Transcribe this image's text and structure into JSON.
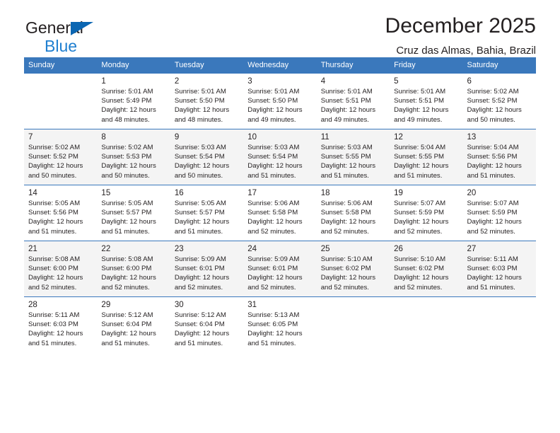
{
  "brand": {
    "line1": "General",
    "line2": "Blue",
    "triangle_color": "#0b66b2",
    "line2_color": "#1f7fd0"
  },
  "header": {
    "title": "December 2025",
    "location": "Cruz das Almas, Bahia, Brazil",
    "header_bg": "#3a78bc",
    "header_text_color": "#ffffff"
  },
  "calendar": {
    "weekdays": [
      "Sunday",
      "Monday",
      "Tuesday",
      "Wednesday",
      "Thursday",
      "Friday",
      "Saturday"
    ],
    "weeks": [
      [
        {
          "day": "",
          "lines": []
        },
        {
          "day": "1",
          "lines": [
            "Sunrise: 5:01 AM",
            "Sunset: 5:49 PM",
            "Daylight: 12 hours",
            "and 48 minutes."
          ]
        },
        {
          "day": "2",
          "lines": [
            "Sunrise: 5:01 AM",
            "Sunset: 5:50 PM",
            "Daylight: 12 hours",
            "and 48 minutes."
          ]
        },
        {
          "day": "3",
          "lines": [
            "Sunrise: 5:01 AM",
            "Sunset: 5:50 PM",
            "Daylight: 12 hours",
            "and 49 minutes."
          ]
        },
        {
          "day": "4",
          "lines": [
            "Sunrise: 5:01 AM",
            "Sunset: 5:51 PM",
            "Daylight: 12 hours",
            "and 49 minutes."
          ]
        },
        {
          "day": "5",
          "lines": [
            "Sunrise: 5:01 AM",
            "Sunset: 5:51 PM",
            "Daylight: 12 hours",
            "and 49 minutes."
          ]
        },
        {
          "day": "6",
          "lines": [
            "Sunrise: 5:02 AM",
            "Sunset: 5:52 PM",
            "Daylight: 12 hours",
            "and 50 minutes."
          ]
        }
      ],
      [
        {
          "day": "7",
          "lines": [
            "Sunrise: 5:02 AM",
            "Sunset: 5:52 PM",
            "Daylight: 12 hours",
            "and 50 minutes."
          ]
        },
        {
          "day": "8",
          "lines": [
            "Sunrise: 5:02 AM",
            "Sunset: 5:53 PM",
            "Daylight: 12 hours",
            "and 50 minutes."
          ]
        },
        {
          "day": "9",
          "lines": [
            "Sunrise: 5:03 AM",
            "Sunset: 5:54 PM",
            "Daylight: 12 hours",
            "and 50 minutes."
          ]
        },
        {
          "day": "10",
          "lines": [
            "Sunrise: 5:03 AM",
            "Sunset: 5:54 PM",
            "Daylight: 12 hours",
            "and 51 minutes."
          ]
        },
        {
          "day": "11",
          "lines": [
            "Sunrise: 5:03 AM",
            "Sunset: 5:55 PM",
            "Daylight: 12 hours",
            "and 51 minutes."
          ]
        },
        {
          "day": "12",
          "lines": [
            "Sunrise: 5:04 AM",
            "Sunset: 5:55 PM",
            "Daylight: 12 hours",
            "and 51 minutes."
          ]
        },
        {
          "day": "13",
          "lines": [
            "Sunrise: 5:04 AM",
            "Sunset: 5:56 PM",
            "Daylight: 12 hours",
            "and 51 minutes."
          ]
        }
      ],
      [
        {
          "day": "14",
          "lines": [
            "Sunrise: 5:05 AM",
            "Sunset: 5:56 PM",
            "Daylight: 12 hours",
            "and 51 minutes."
          ]
        },
        {
          "day": "15",
          "lines": [
            "Sunrise: 5:05 AM",
            "Sunset: 5:57 PM",
            "Daylight: 12 hours",
            "and 51 minutes."
          ]
        },
        {
          "day": "16",
          "lines": [
            "Sunrise: 5:05 AM",
            "Sunset: 5:57 PM",
            "Daylight: 12 hours",
            "and 51 minutes."
          ]
        },
        {
          "day": "17",
          "lines": [
            "Sunrise: 5:06 AM",
            "Sunset: 5:58 PM",
            "Daylight: 12 hours",
            "and 52 minutes."
          ]
        },
        {
          "day": "18",
          "lines": [
            "Sunrise: 5:06 AM",
            "Sunset: 5:58 PM",
            "Daylight: 12 hours",
            "and 52 minutes."
          ]
        },
        {
          "day": "19",
          "lines": [
            "Sunrise: 5:07 AM",
            "Sunset: 5:59 PM",
            "Daylight: 12 hours",
            "and 52 minutes."
          ]
        },
        {
          "day": "20",
          "lines": [
            "Sunrise: 5:07 AM",
            "Sunset: 5:59 PM",
            "Daylight: 12 hours",
            "and 52 minutes."
          ]
        }
      ],
      [
        {
          "day": "21",
          "lines": [
            "Sunrise: 5:08 AM",
            "Sunset: 6:00 PM",
            "Daylight: 12 hours",
            "and 52 minutes."
          ]
        },
        {
          "day": "22",
          "lines": [
            "Sunrise: 5:08 AM",
            "Sunset: 6:00 PM",
            "Daylight: 12 hours",
            "and 52 minutes."
          ]
        },
        {
          "day": "23",
          "lines": [
            "Sunrise: 5:09 AM",
            "Sunset: 6:01 PM",
            "Daylight: 12 hours",
            "and 52 minutes."
          ]
        },
        {
          "day": "24",
          "lines": [
            "Sunrise: 5:09 AM",
            "Sunset: 6:01 PM",
            "Daylight: 12 hours",
            "and 52 minutes."
          ]
        },
        {
          "day": "25",
          "lines": [
            "Sunrise: 5:10 AM",
            "Sunset: 6:02 PM",
            "Daylight: 12 hours",
            "and 52 minutes."
          ]
        },
        {
          "day": "26",
          "lines": [
            "Sunrise: 5:10 AM",
            "Sunset: 6:02 PM",
            "Daylight: 12 hours",
            "and 52 minutes."
          ]
        },
        {
          "day": "27",
          "lines": [
            "Sunrise: 5:11 AM",
            "Sunset: 6:03 PM",
            "Daylight: 12 hours",
            "and 51 minutes."
          ]
        }
      ],
      [
        {
          "day": "28",
          "lines": [
            "Sunrise: 5:11 AM",
            "Sunset: 6:03 PM",
            "Daylight: 12 hours",
            "and 51 minutes."
          ]
        },
        {
          "day": "29",
          "lines": [
            "Sunrise: 5:12 AM",
            "Sunset: 6:04 PM",
            "Daylight: 12 hours",
            "and 51 minutes."
          ]
        },
        {
          "day": "30",
          "lines": [
            "Sunrise: 5:12 AM",
            "Sunset: 6:04 PM",
            "Daylight: 12 hours",
            "and 51 minutes."
          ]
        },
        {
          "day": "31",
          "lines": [
            "Sunrise: 5:13 AM",
            "Sunset: 6:05 PM",
            "Daylight: 12 hours",
            "and 51 minutes."
          ]
        },
        {
          "day": "",
          "lines": []
        },
        {
          "day": "",
          "lines": []
        },
        {
          "day": "",
          "lines": []
        }
      ]
    ]
  }
}
